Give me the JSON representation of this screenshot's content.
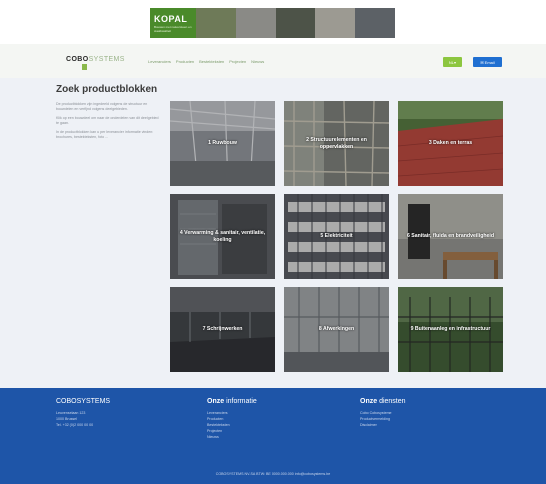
{
  "banner": {
    "brand": "KOPAL",
    "tagline": "Bouwen met natuursteen en staalkwaliteit",
    "photo_colors": [
      "#6e7a58",
      "#8a8a86",
      "#4d5348",
      "#9c9a92",
      "#5c6166"
    ]
  },
  "header": {
    "brand_bold": "COBO",
    "brand_light": "SYSTEMS",
    "nav": [
      "Leveranciers",
      "Producten",
      "Bestekteksten",
      "Projecten",
      "Nieuws"
    ],
    "lang_button": "NL",
    "email_button": "Email"
  },
  "main": {
    "title": "Zoek productblokken",
    "intro": [
      "De productblokken zijn ingedeeld volgens de structuur en bouwdelen en verfijnd volgens deelgebieden.",
      "Klik op een bouwdeel om naar de onderdelen van dit deelgebied te gaan.",
      "In de productblokken kan u per leverancier informatie vinden: brochures, bestekteksten, foto ..."
    ],
    "tiles": [
      {
        "label": "1 Ruwbouw"
      },
      {
        "label": "2 Structuurelementen en oppervlakken"
      },
      {
        "label": "3 Daken en terras"
      },
      {
        "label": "4 Verwarming & sanitair, ventilatie, koeling"
      },
      {
        "label": "5 Elektriciteit"
      },
      {
        "label": "6 Sanitair, fluida en brandveiligheid"
      },
      {
        "label": "7 Schrijnwerken"
      },
      {
        "label": "8 Afwerkingen"
      },
      {
        "label": "9 Buitenaanleg en infrastructuur"
      }
    ]
  },
  "footer": {
    "company": "COBOSYSTEMS",
    "address": [
      "Leuvenselaan 123",
      "1000 Brussel",
      "Tel. +32 (0)2 000 00 00"
    ],
    "info_title_bold": "Onze",
    "info_title_rest": " informatie",
    "info_links": [
      "Leveranciers",
      "Producten",
      "Bestekteksten",
      "Projecten",
      "Nieuws"
    ],
    "services_title_bold": "Onze",
    "services_title_rest": " diensten",
    "services_links": [
      "Cobo Cobosysteme",
      "Productvermelding",
      "Disclaimer"
    ],
    "bottom": "COBOSYSTEMS NV-SA    BTW: BE 0000.000.000    info@cobosystems.be"
  },
  "colors": {
    "accent_green": "#8cc63f",
    "button_blue": "#1f6fd1",
    "footer_blue": "#1e55a8"
  }
}
